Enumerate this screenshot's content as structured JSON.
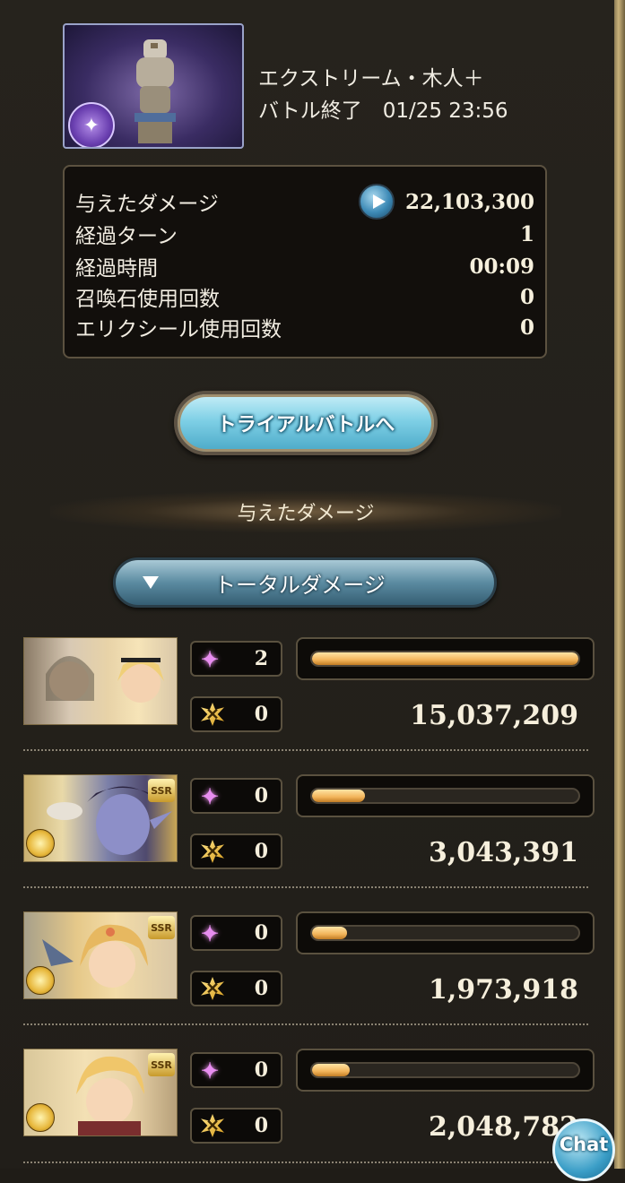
{
  "quest": {
    "title": "エクストリーム・木人＋",
    "status": "バトル終了　01/25 23:56",
    "image": "training-dummy-thumbnail",
    "element_icon": "dark-element-icon"
  },
  "stats": [
    {
      "label": "与えたダメージ",
      "value": "22,103,300",
      "icon": "replay-icon"
    },
    {
      "label": "経過ターン",
      "value": "1"
    },
    {
      "label": "経過時間",
      "value": "00:09"
    },
    {
      "label": "召喚石使用回数",
      "value": "0"
    },
    {
      "label": "エリクシール使用回数",
      "value": "0"
    }
  ],
  "trial_button": "トライアルバトルへ",
  "section_header": "与えたダメージ",
  "total_select": {
    "label": "トータルダメージ",
    "icon": "dropdown-triangle-icon"
  },
  "characters": [
    {
      "name": "main-character",
      "skill_count": "2",
      "ougi_count": "0",
      "damage": "15,037,209",
      "bar_fraction": 1.0,
      "rarity": ""
    },
    {
      "name": "character-2",
      "skill_count": "0",
      "ougi_count": "0",
      "damage": "3,043,391",
      "bar_fraction": 0.2,
      "rarity": "SSR"
    },
    {
      "name": "character-3",
      "skill_count": "0",
      "ougi_count": "0",
      "damage": "1,973,918",
      "bar_fraction": 0.13,
      "rarity": "SSR"
    },
    {
      "name": "character-4",
      "skill_count": "0",
      "ougi_count": "0",
      "damage": "2,048,782",
      "bar_fraction": 0.14,
      "rarity": "SSR"
    }
  ],
  "chat_button": "Chat",
  "colors": {
    "accent": "#7fd0e6",
    "bar": "#f2b45a",
    "skill": "#e88ef0"
  }
}
